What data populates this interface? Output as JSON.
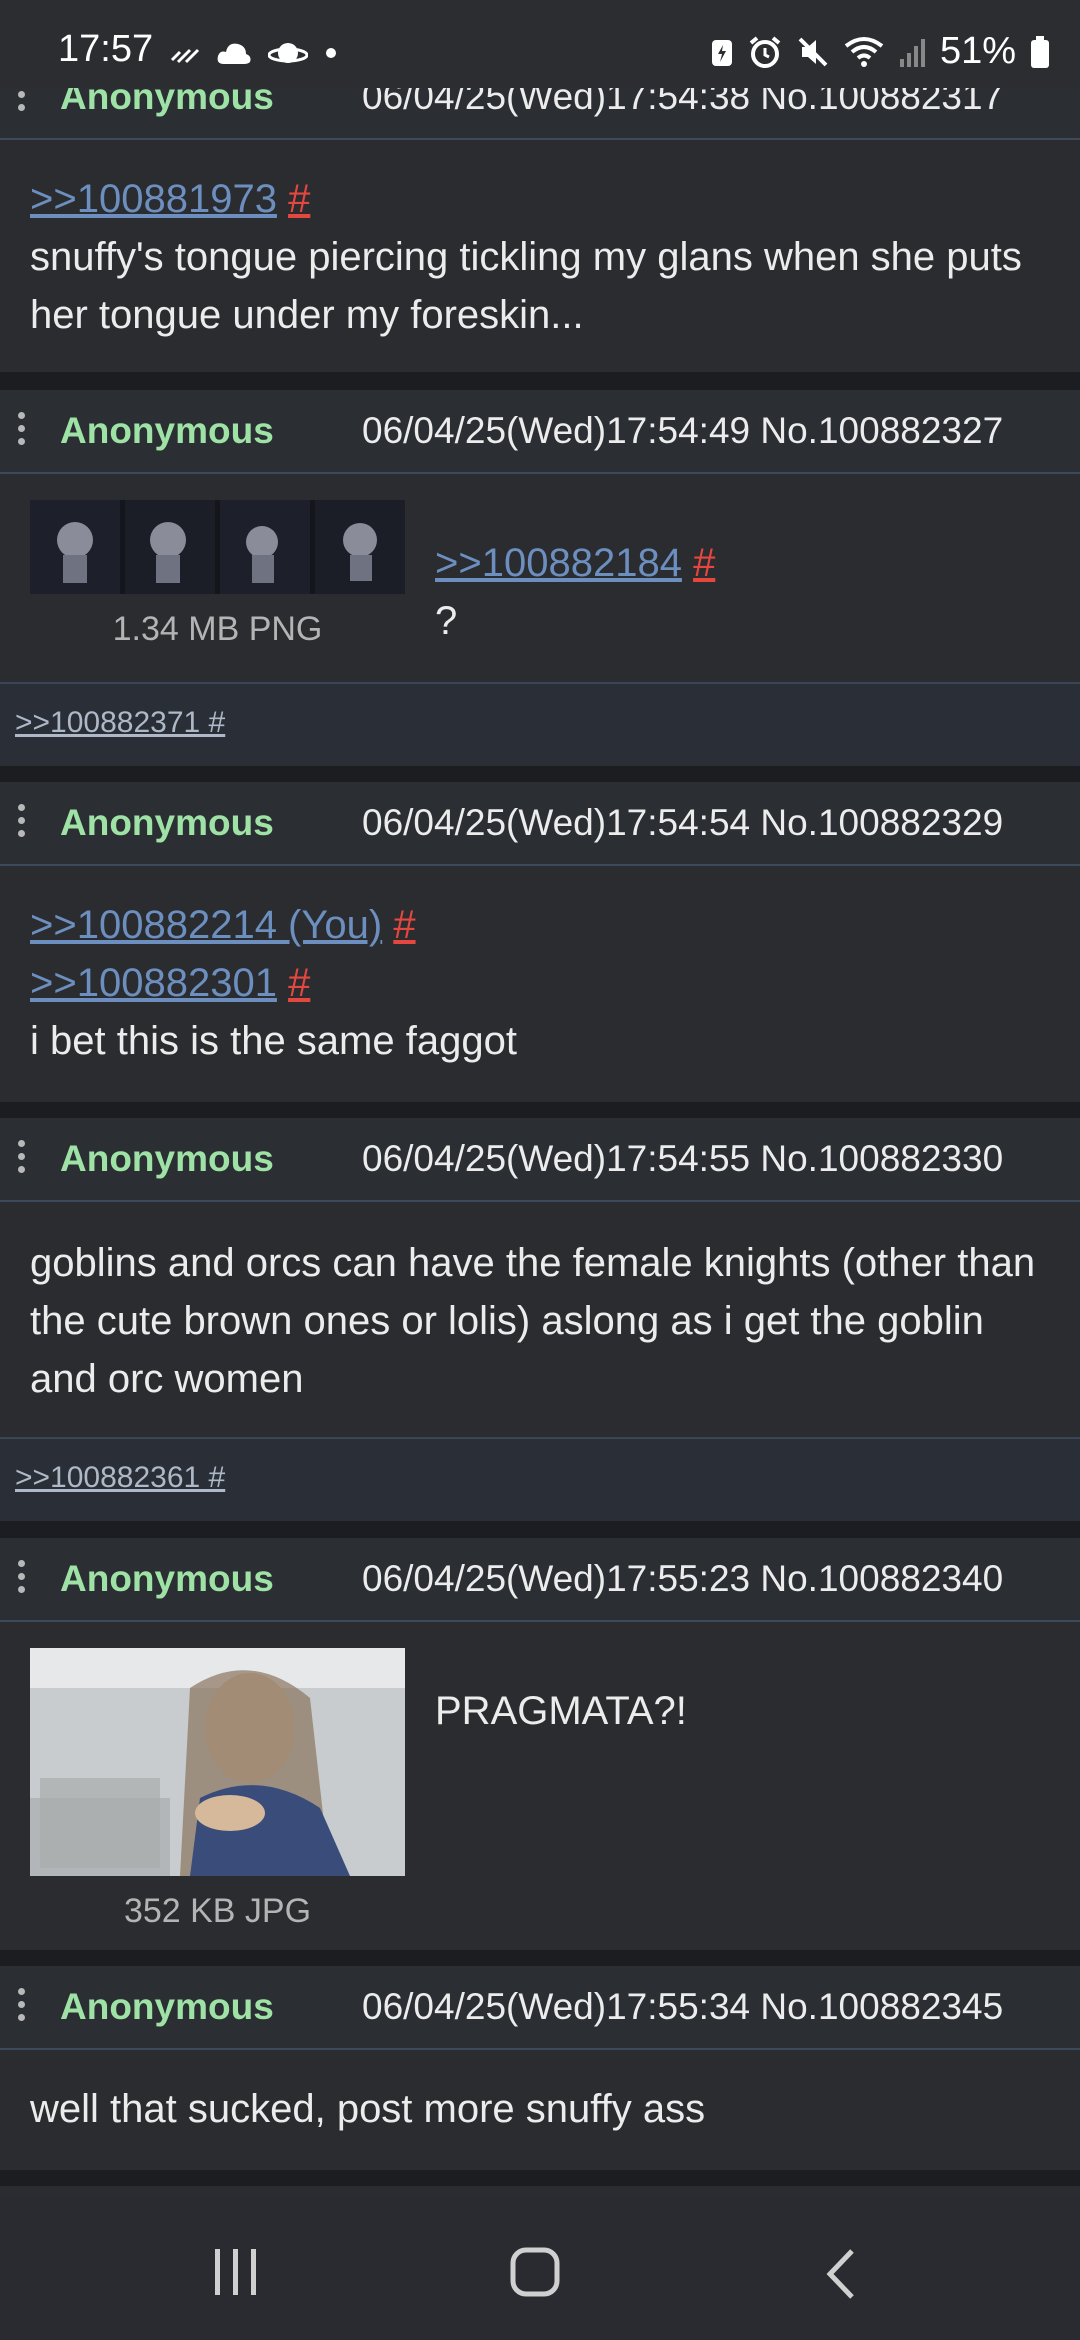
{
  "status_bar": {
    "time": "17:57",
    "battery": "51%",
    "icons_left": [
      "signal-activity-icon",
      "cloud-icon",
      "saturn-icon",
      "dot-icon"
    ],
    "icons_right": [
      "battery-saver-icon",
      "alarm-icon",
      "mute-icon",
      "wifi-icon",
      "cell-signal-icon",
      "battery-icon"
    ]
  },
  "posts": [
    {
      "name": "Anonymous",
      "meta": "06/04/25(Wed)17:54:38 No.100882317",
      "quotes": [
        {
          "ref": ">>100881973",
          "hash": "#"
        }
      ],
      "text": "snuffy's tongue piercing tickling my glans when she puts her tongue under my foreskin..."
    },
    {
      "name": "Anonymous",
      "meta": "06/04/25(Wed)17:54:49 No.100882327",
      "file": "1.34 MB PNG",
      "quotes": [
        {
          "ref": ">>100882184",
          "hash": "#"
        }
      ],
      "text": "?",
      "backlink": ">>100882371 #"
    },
    {
      "name": "Anonymous",
      "meta": "06/04/25(Wed)17:54:54 No.100882329",
      "quotes": [
        {
          "ref": ">>100882214 (You)",
          "hash": "#"
        },
        {
          "ref": ">>100882301",
          "hash": "#"
        }
      ],
      "text": "i bet this is the same faggot"
    },
    {
      "name": "Anonymous",
      "meta": "06/04/25(Wed)17:54:55 No.100882330",
      "text": "goblins and orcs can have the female knights (other than the cute brown ones or lolis) aslong as i get the goblin and orc women",
      "backlink": ">>100882361 #"
    },
    {
      "name": "Anonymous",
      "meta": "06/04/25(Wed)17:55:23 No.100882340",
      "file": "352 KB JPG",
      "text": "PRAGMATA?!"
    },
    {
      "name": "Anonymous",
      "meta": "06/04/25(Wed)17:55:34 No.100882345",
      "text": "well that sucked, post more snuffy ass"
    }
  ],
  "nav_bar": [
    "recent-apps-icon",
    "home-icon",
    "back-icon"
  ]
}
